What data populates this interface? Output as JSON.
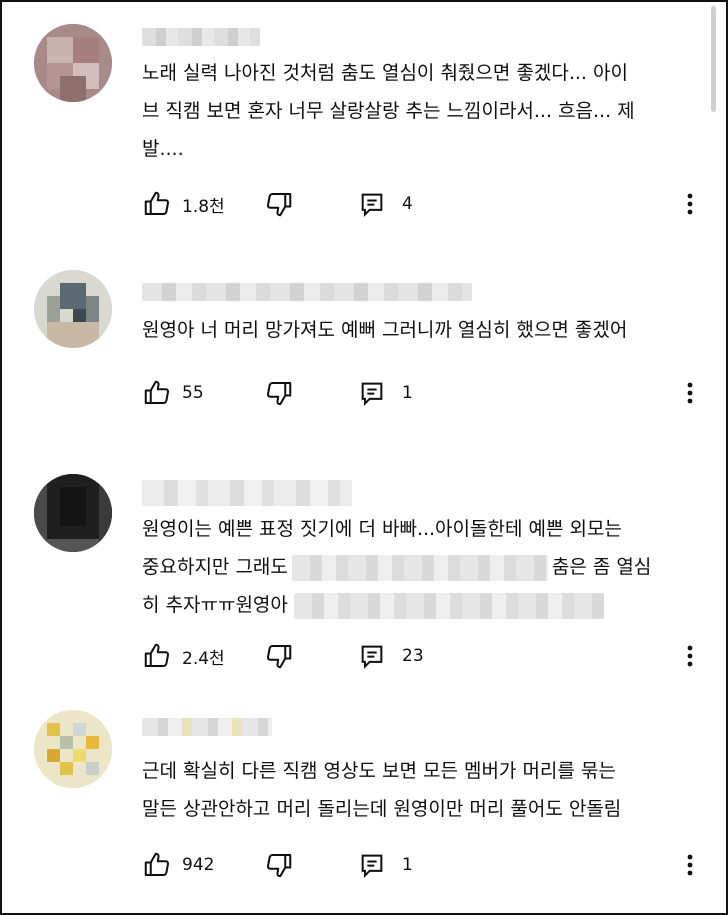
{
  "comments": [
    {
      "lines": [
        "노래 실력 나아진 것처럼 춤도 열심이 춰줬으면 좋겠다... 아이",
        "브 직캠 보면 혼자 너무 살랑살랑 추는 느낌이라서... 흐음... 제",
        "발...."
      ],
      "likes": "1.8천",
      "replies": "4"
    },
    {
      "lines": [
        "원영아 너 머리 망가져도 예뻐 그러니까 열심히 했으면 좋겠어"
      ],
      "likes": "55",
      "replies": "1"
    },
    {
      "line1": "원영이는 예쁜 표정 짓기에 더 바빠...아이돌한테 예쁜 외모는",
      "line2_start": "중요하지만 그래도",
      "line2_end": "춤은 좀 열심",
      "line3_start": "히 추자ㅠㅠ원영아",
      "likes": "2.4천",
      "replies": "23"
    },
    {
      "lines": [
        "근데 확실히 다른 직캠 영상도 보면 모든 멤버가 머리를 묶는",
        "말든 상관안하고 머리 돌리는데 원영이만 머리 풀어도 안돌림"
      ],
      "likes": "942",
      "replies": "1"
    }
  ],
  "icons": {
    "like": "thumb-up-icon",
    "dislike": "thumb-down-icon",
    "reply": "comment-icon",
    "more": "more-vert-icon"
  }
}
